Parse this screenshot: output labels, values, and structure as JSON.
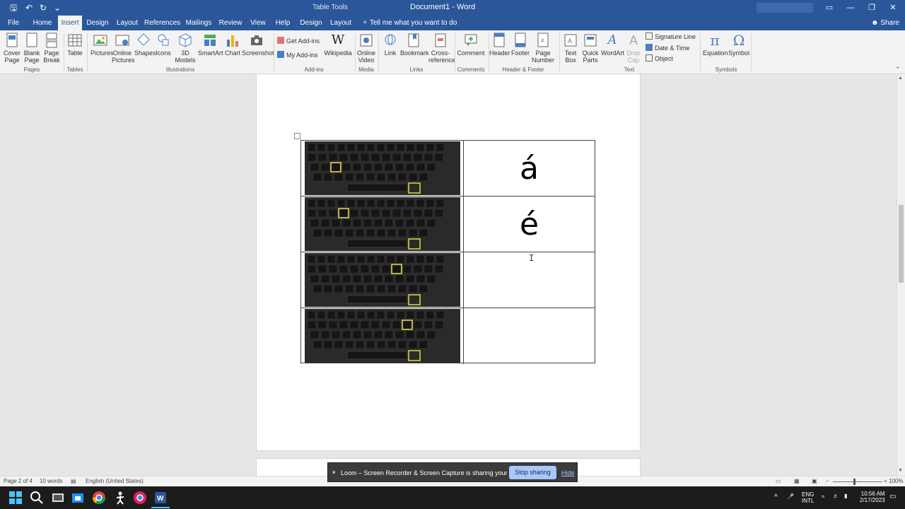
{
  "titlebar": {
    "table_tools": "Table Tools",
    "document_title": "Document1 - Word",
    "quick_access": {
      "save": "🖫",
      "undo": "↶",
      "redo": "↻",
      "customize": "⌄"
    },
    "window_controls": {
      "ribbon_display": "▭",
      "minimize": "—",
      "restore": "❐",
      "close": "✕"
    }
  },
  "tabs": [
    "File",
    "Home",
    "Insert",
    "Design",
    "Layout",
    "References",
    "Mailings",
    "Review",
    "View",
    "Help",
    "Design",
    "Layout"
  ],
  "active_tab": "Insert",
  "tell_me": "Tell me what you want to do",
  "share": "Share",
  "ribbon": {
    "pages": {
      "cover_page": "Cover\nPage",
      "blank_page": "Blank\nPage",
      "page_break": "Page\nBreak",
      "label": "Pages"
    },
    "tables": {
      "table": "Table",
      "label": "Tables"
    },
    "illustrations": {
      "pictures": "Pictures",
      "online_pictures": "Online\nPictures",
      "shapes": "Shapes",
      "icons": "Icons",
      "models_3d": "3D\nModels",
      "smartart": "SmartArt",
      "chart": "Chart",
      "screenshot": "Screenshot",
      "label": "Illustrations"
    },
    "addins": {
      "get_addins": "Get Add-ins",
      "my_addins": "My Add-ins",
      "wikipedia": "Wikipedia",
      "label": "Add-ins"
    },
    "media": {
      "online_video": "Online\nVideo",
      "label": "Media"
    },
    "links": {
      "link": "Link",
      "bookmark": "Bookmark",
      "cross_reference": "Cross-\nreference",
      "label": "Links"
    },
    "comments": {
      "comment": "Comment",
      "label": "Comments"
    },
    "header_footer": {
      "header": "Header",
      "footer": "Footer",
      "page_number": "Page\nNumber",
      "label": "Header & Footer"
    },
    "text": {
      "text_box": "Text\nBox",
      "quick_parts": "Quick\nParts",
      "wordart": "WordArt",
      "drop_cap": "Drop\nCap",
      "signature_line": "Signature Line",
      "date_time": "Date & Time",
      "object": "Object",
      "label": "Text"
    },
    "symbols": {
      "equation": "Equation",
      "symbol": "Symbol",
      "label": "Symbols"
    }
  },
  "document": {
    "rows": [
      {
        "highlight_key": "A",
        "character": "á"
      },
      {
        "highlight_key": "E",
        "character": "é"
      },
      {
        "highlight_key": "I",
        "character": ""
      },
      {
        "highlight_key": "O",
        "character": ""
      }
    ]
  },
  "status": {
    "page": "Page 2 of 4",
    "words": "10 words",
    "language": "English (United States)",
    "zoom": "100%",
    "zoom_out": "−",
    "zoom_in": "+"
  },
  "loom": {
    "pause": "⏸",
    "message": "Loom – Screen Recorder & Screen Capture is sharing your screen.",
    "stop": "Stop sharing",
    "hide": "Hide"
  },
  "taskbar": {
    "lang1": "ENG",
    "lang2": "INTL",
    "time": "10:56 AM",
    "date": "2/17/2023",
    "tray_arrow": "^"
  },
  "colors": {
    "word_blue": "#2b579a",
    "ribbon_bg": "#f3f3f3",
    "highlight_yellow": "#e8d84a",
    "loom_button": "#a8c7fa"
  }
}
